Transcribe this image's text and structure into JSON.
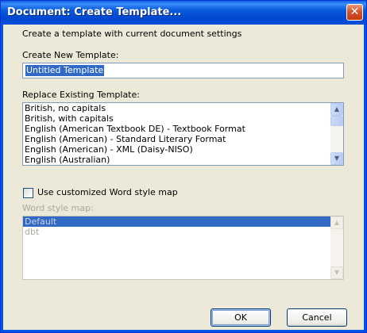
{
  "window": {
    "title": "Document: Create Template..."
  },
  "description": "Create a template with current document settings",
  "new_template": {
    "label": "Create New Template:",
    "value": "Untitled Template"
  },
  "replace": {
    "label": "Replace Existing Template:",
    "items": [
      "British, no capitals",
      "British, with capitals",
      "English (American Textbook DE) - Textbook Format",
      "English (American) - Standard Literary Format",
      "English (American) - XML (Daisy-NISO)",
      "English (Australian)"
    ]
  },
  "style_map": {
    "checkbox_label": "Use customized Word style map",
    "checked": false,
    "label": "Word style map:",
    "items": [
      "Default",
      "dbt"
    ],
    "selected": "Default"
  },
  "buttons": {
    "ok": "OK",
    "cancel": "Cancel"
  },
  "colors": {
    "titlebar": "#0055e5",
    "face": "#ece9d8",
    "selection": "#316ac5"
  }
}
